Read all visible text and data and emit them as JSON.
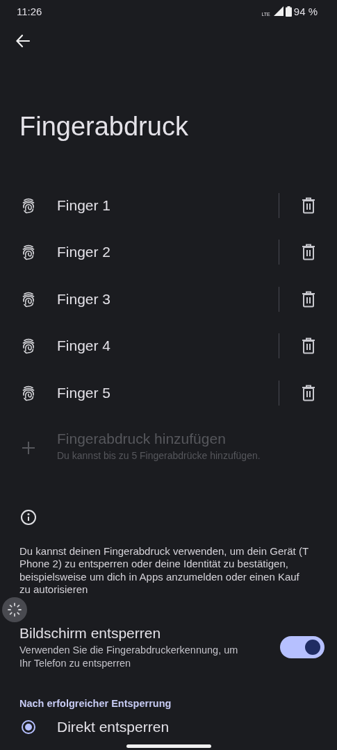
{
  "status_bar": {
    "time": "11:26",
    "network": "LTE",
    "battery": "94 %"
  },
  "title": "Fingerabdruck",
  "fingers": [
    {
      "name": "Finger 1"
    },
    {
      "name": "Finger 2"
    },
    {
      "name": "Finger 3"
    },
    {
      "name": "Finger 4"
    },
    {
      "name": "Finger 5"
    }
  ],
  "add": {
    "label": "Fingerabdruck hinzufügen",
    "hint": "Du kannst bis zu 5 Fingerabdrücke hinzufügen.",
    "disabled": true
  },
  "info": "Du kannst deinen Fingerabdruck verwenden, um dein Gerät (T Phone 2) zu entsperren oder deine Identität zu bestätigen, beispielsweise um dich in Apps anzumelden oder einen Kauf zu autorisieren",
  "unlock_setting": {
    "title": "Bildschirm entsperren",
    "description": "Verwenden Sie die Fingerabdruckerkennung, um Ihr Telefon zu entsperren",
    "on": true
  },
  "section_header": "Nach erfolgreicher Entsperrung",
  "options": [
    {
      "label": "Direkt entsperren",
      "selected": true
    }
  ]
}
